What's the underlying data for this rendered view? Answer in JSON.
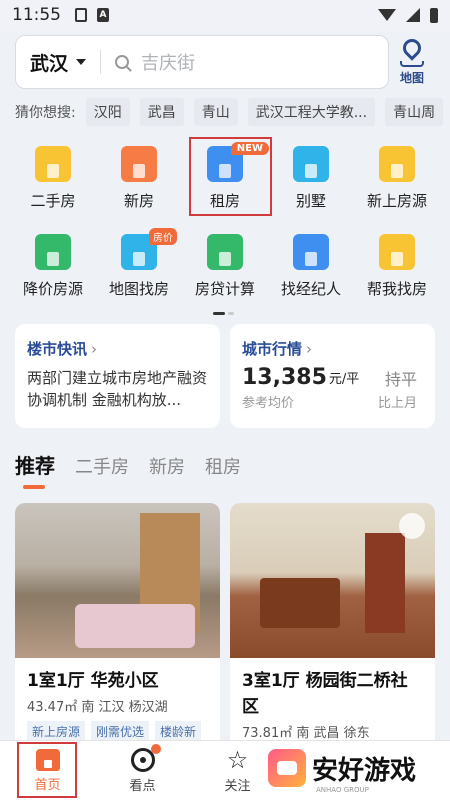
{
  "status": {
    "time": "11:55"
  },
  "search": {
    "city": "武汉",
    "placeholder": "吉庆街"
  },
  "map": {
    "label": "地图"
  },
  "guess": {
    "label": "猜你想搜:",
    "chips": [
      "汉阳",
      "武昌",
      "青山",
      "武汉工程大学教...",
      "青山周"
    ]
  },
  "grid": {
    "row1": [
      {
        "label": "二手房",
        "icon": "second-hand-house-icon",
        "color": "yellow"
      },
      {
        "label": "新房",
        "icon": "new-house-icon",
        "color": "orange"
      },
      {
        "label": "租房",
        "icon": "rent-house-icon",
        "color": "blue",
        "badge": "NEW"
      },
      {
        "label": "别墅",
        "icon": "villa-icon",
        "color": "teal"
      },
      {
        "label": "新上房源",
        "icon": "new-listing-icon",
        "color": "yellow"
      }
    ],
    "row2": [
      {
        "label": "降价房源",
        "icon": "price-drop-icon",
        "color": "green"
      },
      {
        "label": "地图找房",
        "icon": "map-search-icon",
        "color": "teal",
        "badge": "房价"
      },
      {
        "label": "房贷计算",
        "icon": "mortgage-calc-icon",
        "color": "green"
      },
      {
        "label": "找经纪人",
        "icon": "agent-icon",
        "color": "blue"
      },
      {
        "label": "帮我找房",
        "icon": "help-find-icon",
        "color": "yellow"
      }
    ]
  },
  "news_card": {
    "title": "楼市快讯",
    "text": "两部门建立城市房地产融资协调机制 金融机构放..."
  },
  "market_card": {
    "title": "城市行情",
    "price": "13,385",
    "unit": "元/平",
    "trend": "持平",
    "price_caption": "参考均价",
    "trend_caption": "比上月"
  },
  "tabs": [
    "推荐",
    "二手房",
    "新房",
    "租房"
  ],
  "listings": [
    {
      "title": "1室1厅 华苑小区",
      "meta": "43.47㎡ 南 江汉 杨汉湖",
      "tags": [
        "新上房源",
        "刚需优选",
        "楼龄新"
      ]
    },
    {
      "title": "3室1厅 杨园街二桥社区",
      "meta": "73.81㎡ 南 武昌 徐东",
      "tags": []
    }
  ],
  "bottom_nav": [
    {
      "label": "首页",
      "icon": "home-icon"
    },
    {
      "label": "看点",
      "icon": "target-icon"
    },
    {
      "label": "关注",
      "icon": "star-icon"
    }
  ],
  "watermark": {
    "text": "安好游戏",
    "sub": "ANHAO GROUP"
  },
  "colors": {
    "accent": "#f06a3a",
    "brand_blue": "#2a4c96",
    "highlight": "#d23b3b"
  }
}
